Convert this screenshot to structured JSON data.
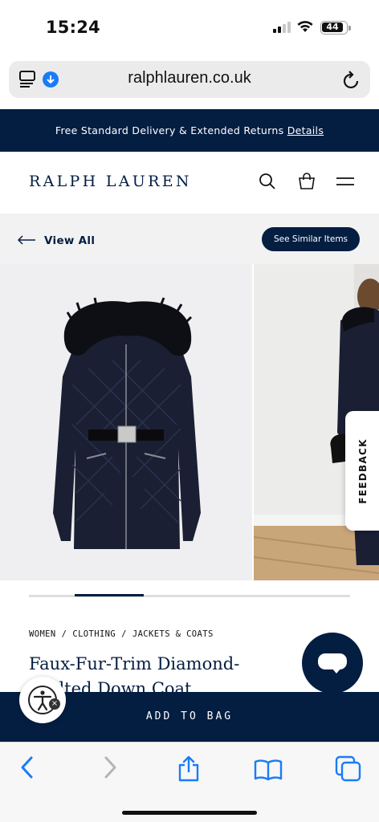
{
  "status": {
    "time": "15:24",
    "battery": "44"
  },
  "browser": {
    "url": "ralphlauren.co.uk"
  },
  "promo": {
    "text": "Free Standard Delivery & Extended Returns",
    "link": "Details"
  },
  "header": {
    "logo": "RALPH LAUREN"
  },
  "toolbar": {
    "view_all": "View All",
    "see_similar": "See Similar Items"
  },
  "gallery": {
    "slide_count": 4,
    "active_slide": 2,
    "feedback_label": "FEEDBACK"
  },
  "product": {
    "breadcrumb": [
      "WOMEN",
      "CLOTHING",
      "JACKETS & COATS"
    ],
    "title": "Faux-Fur-Trim Diamond-Quilted Down Coat",
    "add_to_bag": "ADD TO BAG"
  },
  "colors": {
    "navy": "#041e42",
    "safari_blue": "#1a7cf5"
  }
}
